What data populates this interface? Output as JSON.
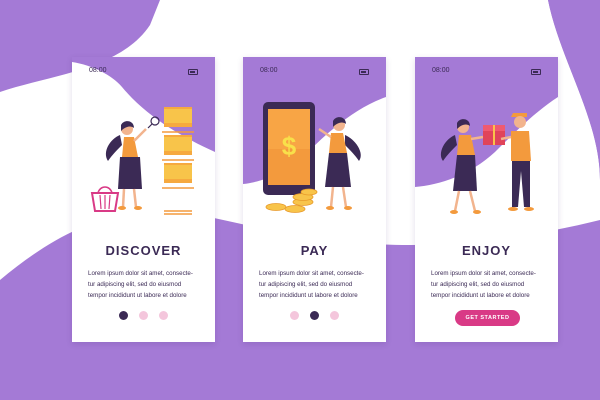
{
  "screens": [
    {
      "time": "08:00",
      "title": "DISCOVER",
      "body": [
        "Lorem ipsum dolor sit amet, consecte-",
        "tur adipiscing elit, sed do eiusmod",
        "tempor incididunt ut labore et dolore"
      ]
    },
    {
      "time": "08:00",
      "title": "PAY",
      "body": [
        "Lorem ipsum dolor sit amet, consecte-",
        "tur adipiscing elit, sed do eiusmod",
        "tempor incididunt ut labore et dolore"
      ]
    },
    {
      "time": "08:00",
      "title": "ENJOY",
      "body": [
        "Lorem ipsum dolor sit amet, consecte-",
        "tur adipiscing elit, sed do eiusmod",
        "tempor incididunt ut labore et dolore"
      ],
      "button_label": "GET STARTED"
    }
  ],
  "pagination": {
    "active": "#3b2a55",
    "inactive": "#f4c6dc"
  },
  "colors": {
    "purple": "#a47ad6",
    "navy": "#3b2a55",
    "accent": "#d93a86",
    "orange": "#f39a3d",
    "yellow": "#f8c44a"
  },
  "icons": [
    "battery-icon",
    "magnifier-icon",
    "shopping-basket-icon",
    "dollar-icon",
    "coin-stack-icon",
    "gift-box-icon"
  ]
}
